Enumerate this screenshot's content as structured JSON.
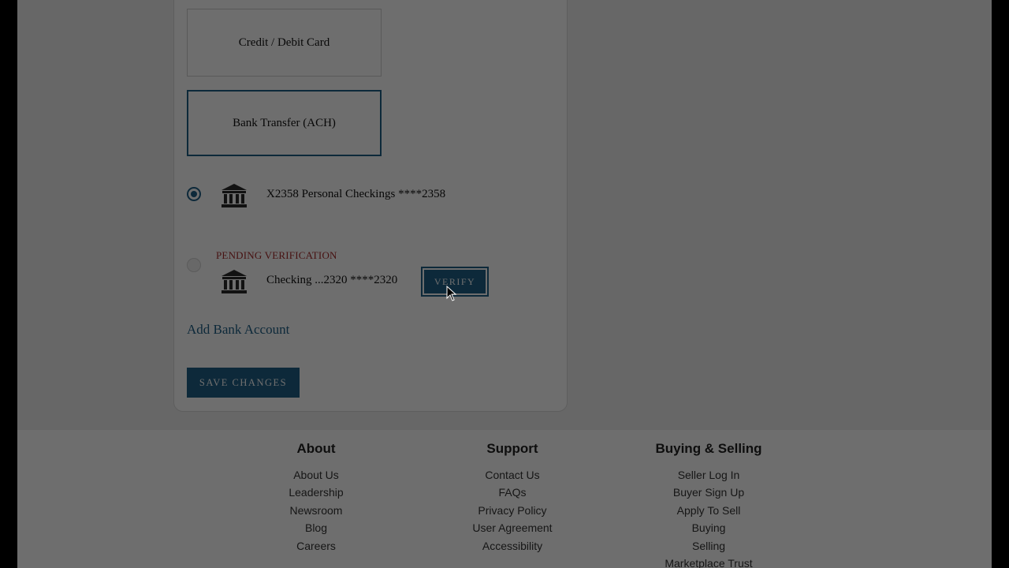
{
  "payment_methods": {
    "card_label": "Credit / Debit Card",
    "ach_label": "Bank Transfer (ACH)"
  },
  "accounts": [
    {
      "name": "X2358 Personal Checkings ****2358",
      "selected": true,
      "icon": "bank-icon"
    },
    {
      "status": "PENDING VERIFICATION",
      "name": "Checking ...2320 ****2320",
      "selected": false,
      "icon": "bank-icon",
      "action": "VERIFY"
    }
  ],
  "add_bank_label": "Add Bank Account",
  "save_label": "SAVE CHANGES",
  "footer": {
    "about": {
      "title": "About",
      "links": [
        "About Us",
        "Leadership",
        "Newsroom",
        "Blog",
        "Careers"
      ]
    },
    "support": {
      "title": "Support",
      "links": [
        "Contact Us",
        "FAQs",
        "Privacy Policy",
        "User Agreement",
        "Accessibility"
      ]
    },
    "buying_selling": {
      "title": "Buying & Selling",
      "links": [
        "Seller Log In",
        "Buyer Sign Up",
        "Apply To Sell",
        "Buying",
        "Selling",
        "Marketplace Trust"
      ]
    }
  },
  "colors": {
    "accent": "#1e5f86",
    "pending": "#a52a2a",
    "overlay": "rgba(0,0,0,0.57)"
  }
}
